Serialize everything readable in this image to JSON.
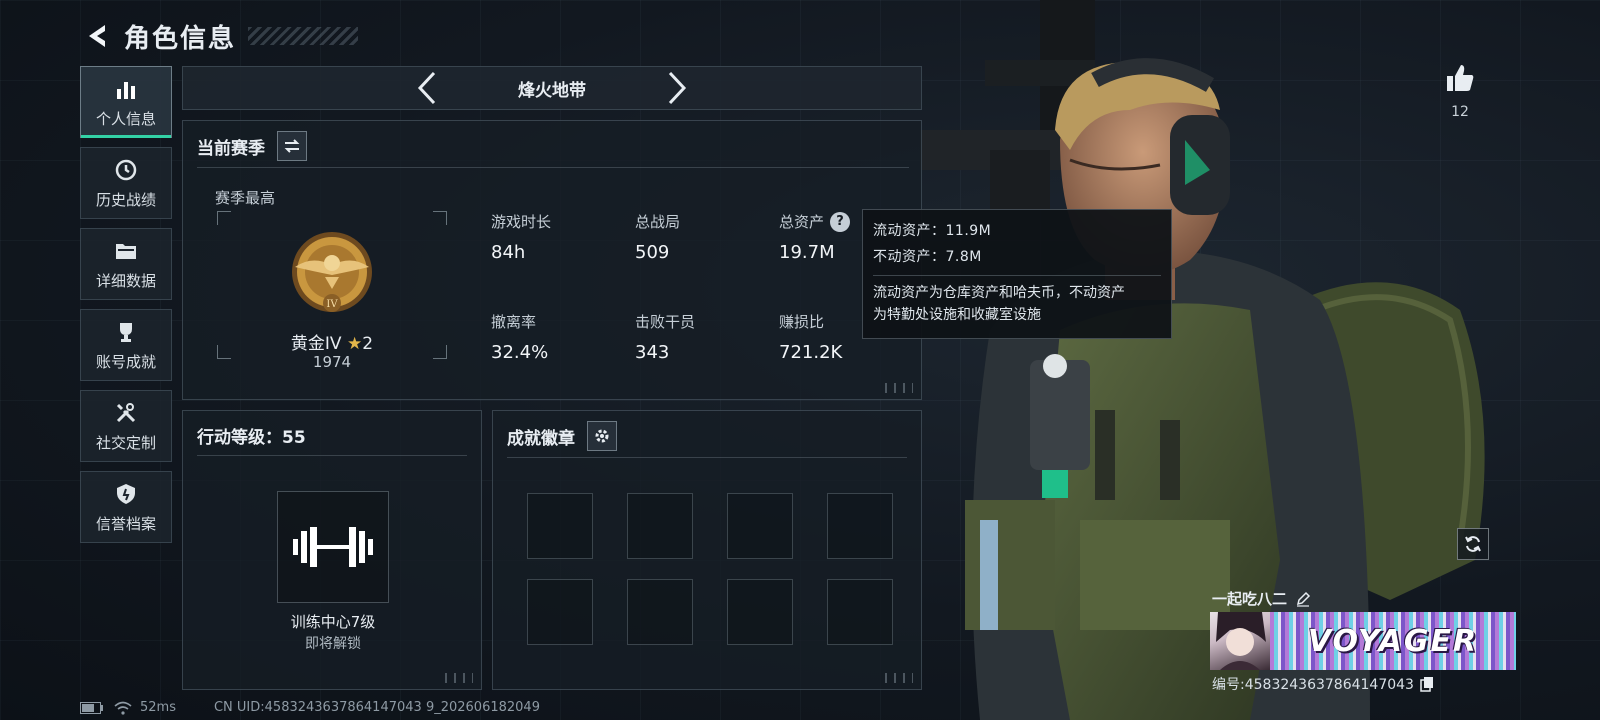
{
  "header": {
    "title": "角色信息"
  },
  "sidebar": {
    "items": [
      {
        "label": "个人信息",
        "icon": "bar-chart-icon",
        "active": true
      },
      {
        "label": "历史战绩",
        "icon": "clock-icon"
      },
      {
        "label": "详细数据",
        "icon": "folder-icon"
      },
      {
        "label": "账号成就",
        "icon": "trophy-icon"
      },
      {
        "label": "社交定制",
        "icon": "tools-icon"
      },
      {
        "label": "信誉档案",
        "icon": "shield-icon"
      }
    ]
  },
  "mode": {
    "name": "烽火地带"
  },
  "season": {
    "title": "当前赛季",
    "best_label": "赛季最高",
    "rank_name": "黄金IV",
    "rank_stars": "2",
    "rank_score": "1974",
    "rank_numeral": "IV",
    "stats": [
      {
        "label": "游戏时长",
        "value": "84h"
      },
      {
        "label": "总战局",
        "value": "509"
      },
      {
        "label": "总资产",
        "value": "19.7M"
      },
      {
        "label": "撤离率",
        "value": "32.4%"
      },
      {
        "label": "击败干员",
        "value": "343"
      },
      {
        "label": "赚损比",
        "value": "721.2K"
      }
    ]
  },
  "tooltip": {
    "liquid": "流动资产：11.9M",
    "fixed": "不动资产：7.8M",
    "desc_line1": "流动资产为仓库资产和哈夫币，不动资产",
    "desc_line2": "为特勤处设施和收藏室设施"
  },
  "level": {
    "title": "行动等级：55",
    "item_name": "训练中心7级",
    "item_status": "即将解锁"
  },
  "badges": {
    "title": "成就徽章"
  },
  "profile": {
    "likes": "12",
    "player_name": "一起吃八二",
    "banner_text": "VOYAGER",
    "id_text": "编号:4583243637864147043"
  },
  "status_bar": {
    "ping": "52ms",
    "uid": "CN UID:4583243637864147043 9_202606182049"
  },
  "colors": {
    "accent": "#33d2a6",
    "rank_gold": "#c9973f"
  }
}
